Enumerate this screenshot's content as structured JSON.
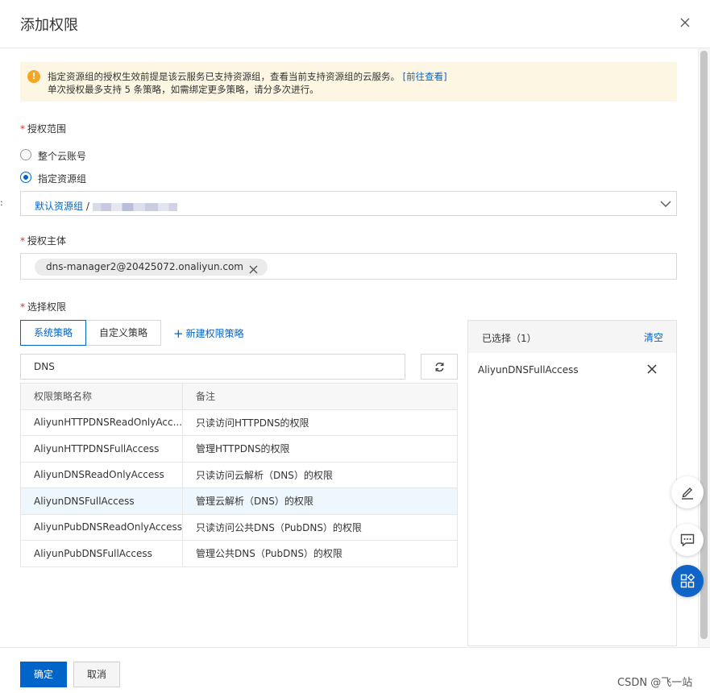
{
  "dialog": {
    "title": "添加权限",
    "close_icon": "close-icon"
  },
  "alert": {
    "icon": "warning-icon",
    "line1": "指定资源组的授权生效前提是该云服务已支持资源组，查看当前支持资源组的云服务。",
    "link": "[前往查看]",
    "line2": "单次授权最多支持 5 条策略，如需绑定更多策略，请分多次进行。"
  },
  "scope": {
    "label": "授权范围",
    "required_mark": "*",
    "options": [
      {
        "label": "整个云账号",
        "checked": false
      },
      {
        "label": "指定资源组",
        "checked": true
      }
    ],
    "select_value_main": "默认资源组",
    "select_value_sep": " /",
    "select_icon": "chevron-down-icon"
  },
  "principal": {
    "label": "授权主体",
    "required_mark": "*",
    "tag": "dns-manager2@20425072.onaliyun.com",
    "tag_remove_icon": "close-icon"
  },
  "permissions": {
    "label": "选择权限",
    "required_mark": "*",
    "tabs": [
      {
        "label": "系统策略",
        "active": true
      },
      {
        "label": "自定义策略",
        "active": false
      }
    ],
    "new_policy_icon": "plus-icon",
    "new_policy": "新建权限策略",
    "search_value": "DNS",
    "refresh_icon": "refresh-icon",
    "table": {
      "columns": [
        "权限策略名称",
        "备注"
      ],
      "rows": [
        {
          "name": "AliyunHTTPDNSReadOnlyAcc...",
          "note": "只读访问HTTPDNS的权限"
        },
        {
          "name": "AliyunHTTPDNSFullAccess",
          "note": "管理HTTPDNS的权限"
        },
        {
          "name": "AliyunDNSReadOnlyAccess",
          "note": "只读访问云解析（DNS）的权限"
        },
        {
          "name": "AliyunDNSFullAccess",
          "note": "管理云解析（DNS）的权限"
        },
        {
          "name": "AliyunPubDNSReadOnlyAccess",
          "note": "只读访问公共DNS（PubDNS）的权限"
        },
        {
          "name": "AliyunPubDNSFullAccess",
          "note": "管理公共DNS（PubDNS）的权限"
        }
      ]
    }
  },
  "selected": {
    "title": "已选择（1）",
    "clear": "清空",
    "items": [
      "AliyunDNSFullAccess"
    ],
    "remove_icon": "close-icon"
  },
  "floating": {
    "edit_icon": "edit-icon",
    "feedback_icon": "chat-icon",
    "apps_icon": "apps-icon"
  },
  "footer": {
    "confirm": "确定",
    "cancel": "取消",
    "watermark": "CSDN @飞一站"
  },
  "colors": {
    "primary": "#0064c8",
    "alert_bg": "#fdf6e3",
    "warning": "#f5a623",
    "required": "#d93026",
    "highlight_row": "#eef6fe"
  }
}
